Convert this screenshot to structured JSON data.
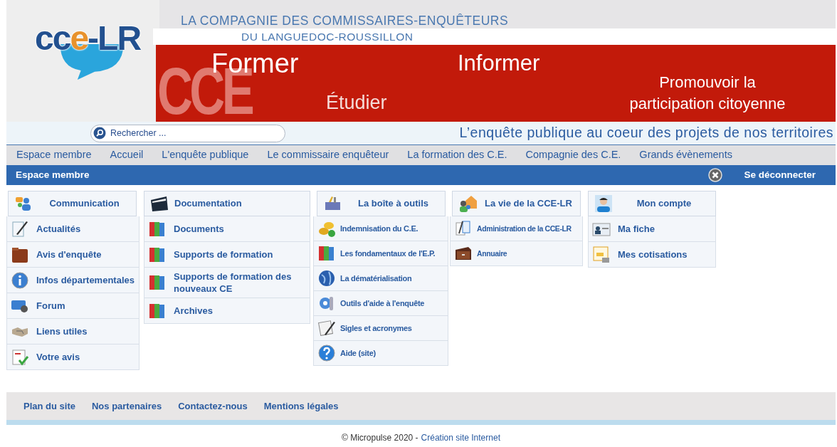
{
  "header": {
    "logo": [
      {
        "text": "cc",
        "color": "#22508f"
      },
      {
        "text": "e",
        "color": "#e8922c"
      },
      {
        "text": "-LR",
        "color": "#22508f"
      }
    ],
    "title_lines": [
      "LA COMPAGNIE DES COMMISSAIRES-ENQUÊTEURS",
      "DU LANGUEDOC-ROUSSILLON"
    ],
    "banner_letters": "CCE",
    "slogans": [
      "Former",
      "Informer",
      "Étudier",
      "Promouvoir la participation citoyenne"
    ]
  },
  "search": {
    "placeholder": "Rechercher ..."
  },
  "tagline": "L’enquête publique au coeur des projets de nos territoires",
  "nav": [
    "Espace membre",
    "Accueil",
    "L'enquête publique",
    "Le commissaire enquêteur",
    "La formation des C.E.",
    "Compagnie des C.E.",
    "Grands évènements"
  ],
  "member_bar": {
    "title": "Espace membre",
    "logout": "Se déconnecter"
  },
  "menus": [
    {
      "title": "Communication",
      "items": [
        "Actualités",
        "Avis d'enquête",
        "Infos départementales",
        "Forum",
        "Liens utiles",
        "Votre avis"
      ]
    },
    {
      "title": "Documentation",
      "items": [
        "Documents",
        "Supports de formation",
        "Supports de formation des nouveaux CE",
        "Archives"
      ]
    },
    {
      "title": "La boîte à outils",
      "items": [
        "Indemnisation du C.E.",
        "Les fondamentaux de l'E.P.",
        "La dématérialisation",
        "Outils d'aide à l'enquête",
        "Sigles et acronymes",
        "Aide (site)"
      ]
    },
    {
      "title": "La vie de la CCE-LR",
      "items": [
        "Administration de la CCE-LR",
        "Annuaire"
      ]
    },
    {
      "title": "Mon compte",
      "items": [
        "Ma fiche",
        "Mes cotisations"
      ]
    }
  ],
  "footer": {
    "links": [
      "Plan du site",
      "Nos partenaires",
      "Contactez-nous",
      "Mentions légales"
    ],
    "copyright": "© Micropulse 2020 -",
    "credit_link": "Création site Internet"
  }
}
